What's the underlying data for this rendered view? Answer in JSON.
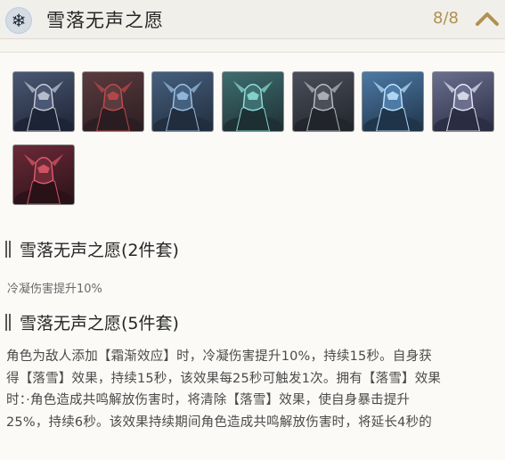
{
  "header": {
    "icon": "snowflake-icon",
    "title": "雪落无声之愿",
    "count": "8/8",
    "collapse_icon": "chevron-up-icon",
    "accent_color": "#b09150"
  },
  "characters": [
    {
      "name": "portrait-1",
      "palette": [
        "#4b5874",
        "#1d2435",
        "#c7ccd9"
      ]
    },
    {
      "name": "portrait-2",
      "palette": [
        "#5b3b3f",
        "#2b1e22",
        "#c24a4a"
      ]
    },
    {
      "name": "portrait-3",
      "palette": [
        "#45607e",
        "#222d3d",
        "#9fc2e6"
      ]
    },
    {
      "name": "portrait-4",
      "palette": [
        "#3f6e70",
        "#1e3034",
        "#8fe0d8"
      ]
    },
    {
      "name": "portrait-5",
      "palette": [
        "#4a4f5a",
        "#22252c",
        "#b8bcc4"
      ]
    },
    {
      "name": "portrait-6",
      "palette": [
        "#4d7aa6",
        "#203449",
        "#bfe4ff"
      ]
    },
    {
      "name": "portrait-7",
      "palette": [
        "#6a6f8f",
        "#2b2e43",
        "#e6e8f5"
      ]
    },
    {
      "name": "portrait-8",
      "palette": [
        "#6b2a38",
        "#2a1219",
        "#e05a6a"
      ]
    }
  ],
  "set2": {
    "heading": "雪落无声之愿(2件套)",
    "effect": "冷凝伤害提升10%"
  },
  "set5": {
    "heading": "雪落无声之愿(5件套)",
    "lines": [
      "角色为敌人添加【霜渐效应】时，冷凝伤害提升10%，持续15秒。自身获",
      "得【落雪】效果，持续15秒，该效果每25秒可触发1次。拥有【落雪】效果",
      "时：·角色造成共鸣解放伤害时，将清除【落雪】效果，使自身暴击提升",
      "25%，持续6秒。该效果持续期间角色造成共鸣解放伤害时，将延长4秒的"
    ]
  }
}
